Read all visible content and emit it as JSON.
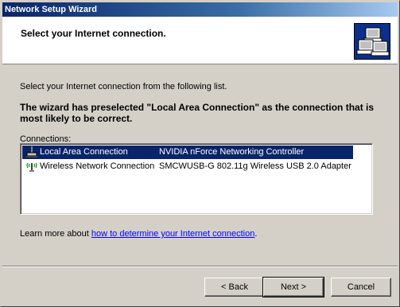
{
  "window": {
    "title": "Network Setup Wizard"
  },
  "header": {
    "title": "Select your Internet connection.",
    "icon": "network-computers-icon"
  },
  "body": {
    "intro": "Select your Internet connection from the following list.",
    "note": "The wizard has preselected \"Local Area Connection\" as the connection that is most likely to be correct.",
    "connections_label": "Connections:",
    "connections": [
      {
        "name": "Local Area Connection",
        "device": "NVIDIA nForce Networking Controller",
        "icon": "wired-network-icon",
        "selected": true
      },
      {
        "name": "Wireless Network Connection",
        "device": "SMCWUSB-G 802.11g Wireless USB 2.0 Adapter",
        "icon": "wireless-network-icon",
        "selected": false
      }
    ],
    "learn_prefix": "Learn more about ",
    "learn_link": "how to determine your Internet connection",
    "learn_suffix": "."
  },
  "buttons": {
    "back": "< Back",
    "next": "Next >",
    "cancel": "Cancel"
  },
  "colors": {
    "selection": "#0a246a",
    "titlebar": "#0a246a",
    "link": "#0000ff"
  }
}
